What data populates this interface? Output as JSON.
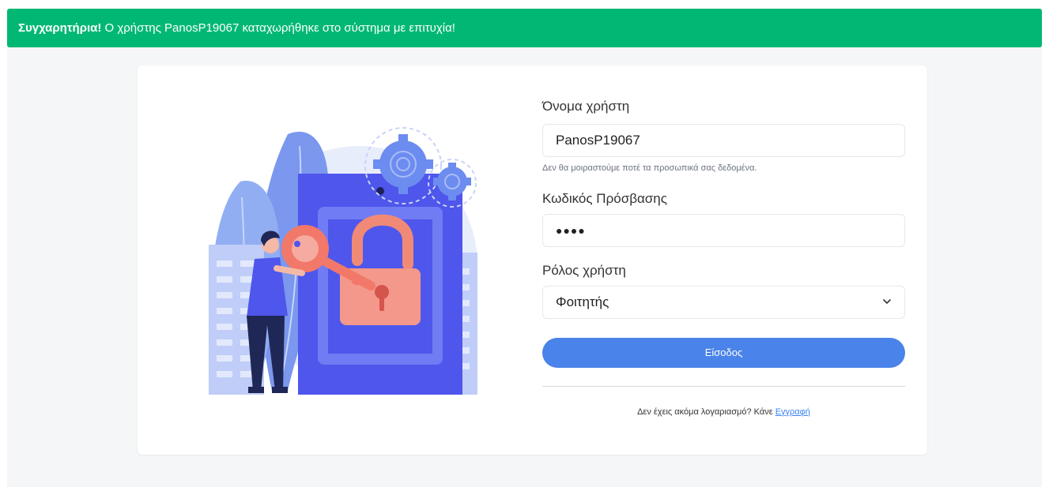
{
  "alert": {
    "strong": "Συγχαρητήρια!",
    "message": "Ο χρήστης PanosP19067 καταχωρήθηκε στο σύστημα με επιτυχία!",
    "color": "#00b873"
  },
  "form": {
    "username_label": "Όνομα χρήστη",
    "username_value": "PanosP19067",
    "username_help": "Δεν θα μοιραστούμε ποτέ τα προσωπικά σας δεδομένα.",
    "password_label": "Κωδικός Πρόσβασης",
    "password_value": "●●●●",
    "role_label": "Ρόλος χρήστη",
    "role_selected": "Φοιτητής",
    "submit_label": "Είσοδος",
    "signup_text": "Δεν έχεις ακόμα λογαριασμό? Κάνε",
    "signup_link": "Εγγραφή"
  },
  "icons": {
    "illustration": "login-lock-key-illustration",
    "chevron": "chevron-down-icon"
  },
  "colors": {
    "primary": "#4a83e9",
    "background": "#f5f6f8"
  }
}
